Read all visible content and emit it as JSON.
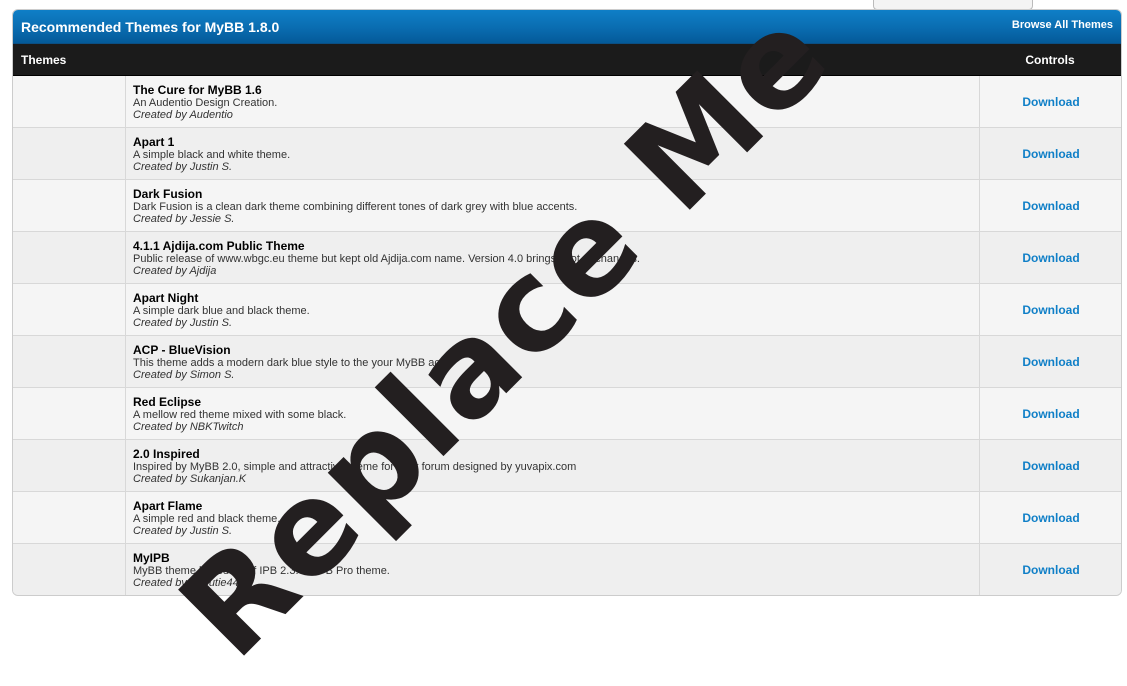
{
  "header": {
    "title": "Recommended Themes for MyBB 1.8.0",
    "browse_all_label": "Browse All Themes"
  },
  "columns": {
    "themes": "Themes",
    "controls": "Controls"
  },
  "themes": [
    {
      "name": "The Cure for MyBB 1.6",
      "description": "An Audentio Design Creation.",
      "author": "Created by Audentio",
      "action": "Download"
    },
    {
      "name": "Apart 1",
      "description": "A simple black and white theme.",
      "author": "Created by Justin S.",
      "action": "Download"
    },
    {
      "name": "Dark Fusion",
      "description": "Dark Fusion is a clean dark theme combining different tones of dark grey with blue accents.",
      "author": "Created by Jessie S.",
      "action": "Download"
    },
    {
      "name": "4.1.1 Ajdija.com Public Theme",
      "description": "Public release of www.wbgc.eu theme but kept old Ajdija.com name. Version 4.0 brings a lot of changes.",
      "author": "Created by Ajdija",
      "action": "Download"
    },
    {
      "name": "Apart Night",
      "description": "A simple dark blue and black theme.",
      "author": "Created by Justin S.",
      "action": "Download"
    },
    {
      "name": "ACP - BlueVision",
      "description": "This theme adds a modern dark blue style to the your MyBB acp.",
      "author": "Created by Simon S.",
      "action": "Download"
    },
    {
      "name": "Red Eclipse",
      "description": "A mellow red theme mixed with some black.",
      "author": "Created by NBKTwitch",
      "action": "Download"
    },
    {
      "name": "2.0 Inspired",
      "description": "Inspired by MyBB 2.0, simple and attractive theme for your forum designed by yuvapix.com",
      "author": "Created by Sukanjan.K",
      "action": "Download"
    },
    {
      "name": "Apart Flame",
      "description": "A simple red and black theme.",
      "author": "Created by Justin S.",
      "action": "Download"
    },
    {
      "name": "MyIPB",
      "description": "MyBB theme based off of IPB 2.3.6's IPB Pro theme.",
      "author": "Created by Scoutie44",
      "action": "Download"
    }
  ],
  "watermark": "Replace Me",
  "colors": {
    "header_blue": "#0a6cb0",
    "column_header": "#1b1b1b",
    "link_blue": "#0f7fc7"
  }
}
